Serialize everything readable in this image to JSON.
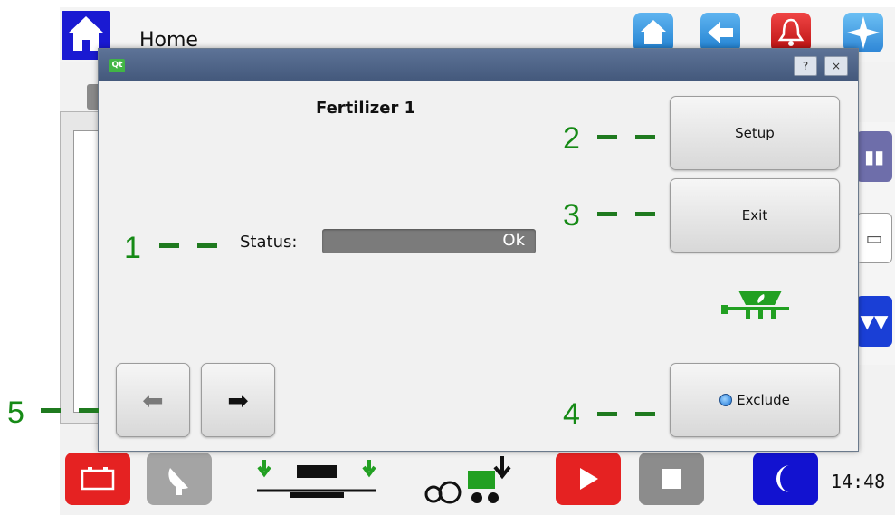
{
  "topbar": {
    "title": "Home"
  },
  "dialog": {
    "app_badge": "Qt",
    "help_label": "?",
    "close_label": "×",
    "title": "Fertilizer 1",
    "status_label": "Status:",
    "status_value": "Ok",
    "setup_label": "Setup",
    "exit_label": "Exit",
    "exclude_label": "Exclude",
    "prev_label": "⬅",
    "next_label": "➡"
  },
  "clock": "14:48",
  "callouts": [
    "1",
    "2",
    "3",
    "4",
    "5"
  ],
  "icons": {
    "topbar": [
      "home-icon",
      "home-icon",
      "back-arrow-icon",
      "alarm-bell-icon",
      "compass-icon"
    ],
    "bottombar": [
      "battery-icon",
      "satellite-dish-icon",
      "seeder-icon",
      "tractor-icon",
      "play-icon",
      "stop-icon",
      "night-mode-icon"
    ],
    "side": [
      "bar-chart-icon",
      "monitor-icon",
      "implement-icon"
    ]
  },
  "colors": {
    "accent_blue": "#1a1ad2",
    "alert_red": "#e52222",
    "callout_green": "#168a16",
    "status_bar": "#7b7b7b"
  }
}
